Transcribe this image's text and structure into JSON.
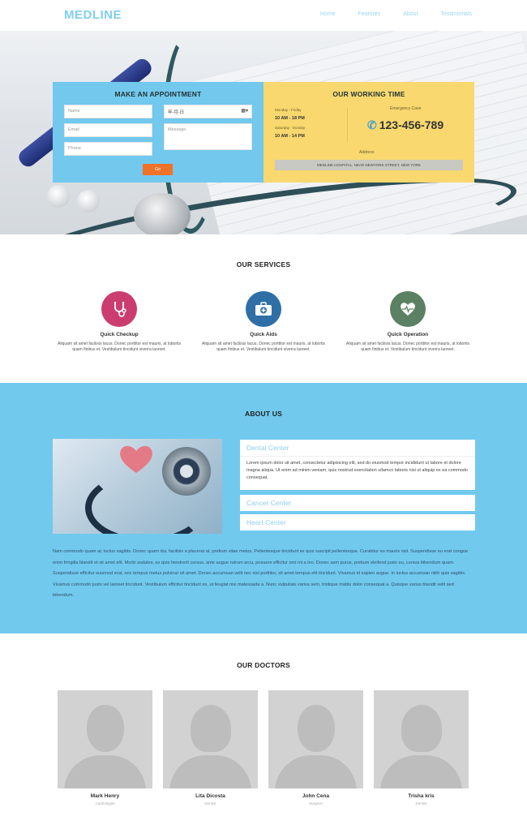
{
  "nav": {
    "logo": "MEDLINE",
    "links": [
      "Home",
      "Features",
      "About",
      "Testimonials"
    ]
  },
  "appointment": {
    "title": "MAKE AN APPOINTMENT",
    "name_placeholder": "Name",
    "email_placeholder": "Email",
    "phone_placeholder": "Phone",
    "date_value": "年-月-日",
    "message_placeholder": "Message",
    "go_label": "Go"
  },
  "working_time": {
    "title": "OUR WORKING TIME",
    "weekday_label": "Monday - Friday",
    "weekday_hours": "10 AM - 18 PM",
    "weekend_label": "Saturday - Sunday",
    "weekend_hours": "10 AM - 14 PM",
    "emergency_label": "Emergency Case",
    "phone": "123-456-789",
    "address_label": "Address",
    "address": "MEDLINE HOSPITAL, NEAR NEWYORK STREET, NEW YORK"
  },
  "services": {
    "title": "OUR SERVICES",
    "items": [
      {
        "name": "Quick Checkup",
        "desc": "Aliquam sit amet facilisis lacus. Donec porttitor est mauris, at lobortis quam finibus et. Vestibulum tincidunt viverra laoreet.",
        "color": "#cc3d6f",
        "icon": "stethoscope-icon"
      },
      {
        "name": "Quick Aids",
        "desc": "Aliquam sit amet facilisis lacus. Donec porttitor est mauris, at lobortis quam finibus et. Vestibulum tincidunt viverra laoreet.",
        "color": "#2f6fa6",
        "icon": "first-aid-kit-icon"
      },
      {
        "name": "Quick Operation",
        "desc": "Aliquam sit amet facilisis lacus. Donec porttitor est mauris, at lobortis quam finibus et. Vestibulum tincidunt viverra laoreet.",
        "color": "#5b8063",
        "icon": "heartbeat-icon"
      }
    ]
  },
  "about": {
    "title": "ABOUT US",
    "accordion": [
      {
        "head": "Dental Center",
        "body": "Lorem ipsum dolor sit amet, consectetur adipisicing elit, sed do eiusmod tempor incididunt ut labore et dolore magna aliqua. Ut enim ad minim veniam, quis nostrud exercitation ullamco laboris nisi ut aliquip ex ea commodo consequat."
      },
      {
        "head": "Cancer Center"
      },
      {
        "head": "Heart Center"
      }
    ],
    "paragraph": "Nam commodo quam ac luctus sagittis. Donec quam dui, facilisis a placerat at, pretium vitae metus. Pellentesque tincidunt ex quis suscipit pellentesque. Curabitur eu mauris nisl. Suspendisse eu erat congue enim fringilla blandit et sit amet elit. Morbi sodales, ex quis hendrerit cursus, ante augue rutrum arcu, posuere efficitur orci mi a leo. Donec sem purus, pretium eleifend justo eu, cursus bibendum quam. Suspendisse efficitur euismod erat, nec tempus metus pulvinar sit amet. Donec accumsan velit nec nisl porttitor, sit amet tempus elit tincidunt. Vivamus id sapien augue. In luctus accumsan nibh quis sagittis. Vivamus commodo justo vel laoreet tincidunt. Vestibulum efficitur tincidunt ex, ut feugiat nisi malesuada a. Nunc vulputate varius sem, tristique mattis dolor consequat a. Quisque varius blandit velit sed bibendum."
  },
  "doctors": {
    "title": "OUR DOCTORS",
    "items": [
      {
        "name": "Mark Henry",
        "role": "Cardiologist",
        "gender": "male"
      },
      {
        "name": "Lita Dicosta",
        "role": "Dentist",
        "gender": "female"
      },
      {
        "name": "John Cena",
        "role": "Surgeon",
        "gender": "male"
      },
      {
        "name": "Trisha kris",
        "role": "Dentist",
        "gender": "female"
      }
    ]
  },
  "colors": {
    "accent_blue": "#72c8ed",
    "accent_yellow": "#f8d86f",
    "go_orange": "#f07228"
  }
}
